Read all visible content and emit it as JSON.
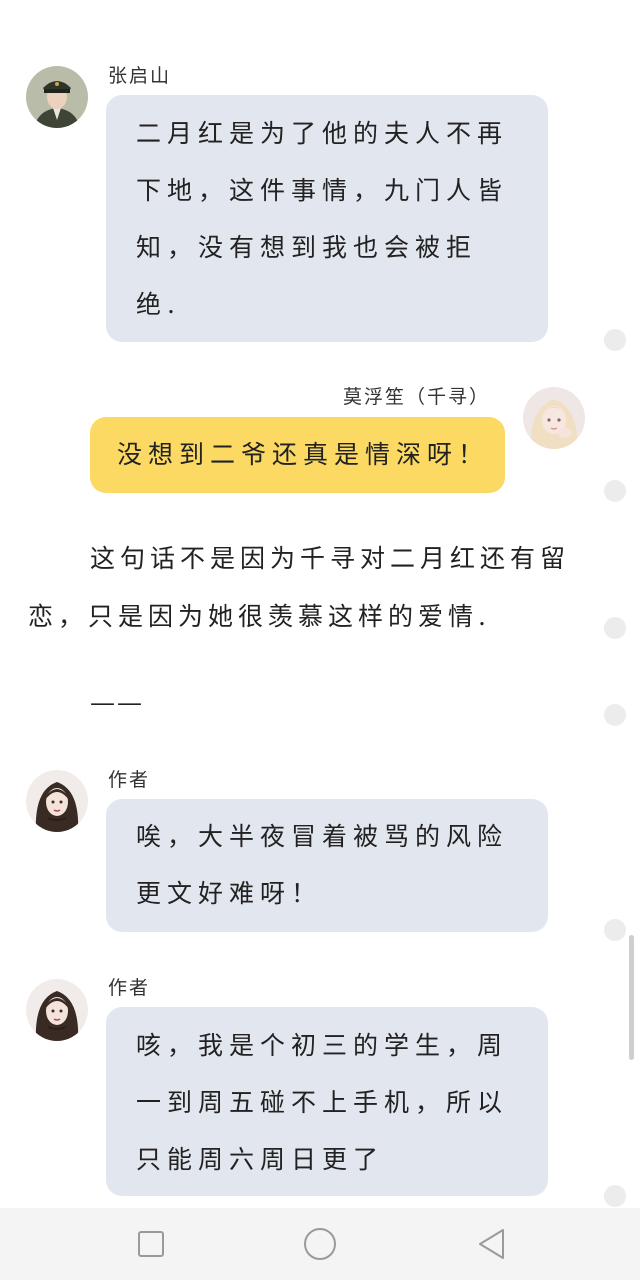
{
  "messages": [
    {
      "sender": "张启山",
      "avatar_icon": "soldier-avatar-icon",
      "lines": [
        "二月红是为了他的夫人不再",
        "下地，这件事情，九门人皆",
        "知，没有想到我也会被拒",
        "绝."
      ]
    },
    {
      "sender": "莫浮笙（千寻）",
      "avatar_icon": "girl-avatar-icon",
      "lines": [
        "没想到二爷还真是情深呀！"
      ]
    },
    {
      "sender": "作者",
      "avatar_icon": "author-avatar-icon",
      "lines": [
        "唉，大半夜冒着被骂的风险",
        "更文好难呀！"
      ]
    },
    {
      "sender": "作者",
      "avatar_icon": "author-avatar-icon",
      "lines": [
        "咳，我是个初三的学生，周",
        "一到周五碰不上手机，所以",
        "只能周六周日更了"
      ]
    }
  ],
  "narration": {
    "lines": [
      "这句话不是因为千寻对二月红还有留",
      "恋，只是因为她很羡慕这样的爱情."
    ],
    "divider": "——"
  },
  "nav": {
    "recent_icon": "square-icon",
    "home_icon": "circle-icon",
    "back_icon": "triangle-back-icon"
  },
  "colors": {
    "bubble_grey": "#e2e7ef",
    "bubble_yellow": "#fbd963",
    "background": "#ffffff",
    "navbar": "#f4f4f4"
  }
}
